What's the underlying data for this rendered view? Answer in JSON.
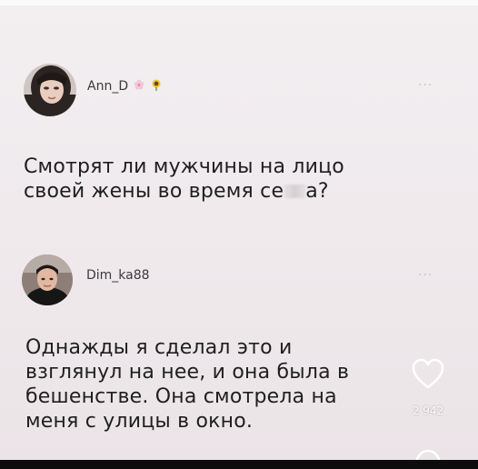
{
  "posts": [
    {
      "username": "Ann_D",
      "badges": [
        "cherry-blossom-icon",
        "sunflower-icon"
      ],
      "text_lines": [
        "Смотрят ли мужчины на лицо",
        "своей жены во время се",
        "а?"
      ],
      "more_label": "···"
    },
    {
      "username": "Dim_ka88",
      "text_lines": [
        "Однажды я сделал это и",
        "взглянул на нее, и она была в",
        "бешенстве. Она смотрела на",
        "меня с улицы в окно."
      ],
      "more_label": "···"
    }
  ],
  "actions": {
    "like_icon": "heart-outline-icon",
    "like_count": "2 942",
    "comment_icon": "comment-bubble-icon"
  },
  "colors": {
    "background": "#f1ecee",
    "text": "#1f1f1f",
    "username": "#3b3b3b",
    "icon": "#ffffff"
  }
}
